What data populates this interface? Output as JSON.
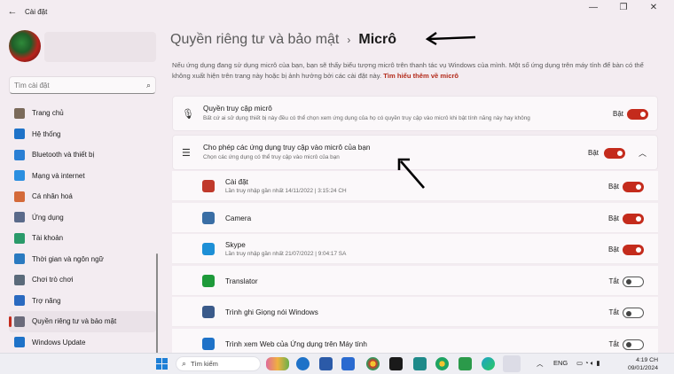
{
  "window": {
    "app_title": "Cài đặt",
    "controls": [
      "—",
      "❐",
      "✕"
    ]
  },
  "sidebar": {
    "search_placeholder": "Tìm cài đặt",
    "items": [
      {
        "label": "Trang chủ",
        "icon": "home-icon",
        "color": "#7a6a5a"
      },
      {
        "label": "Hệ thống",
        "icon": "display-icon",
        "color": "#1e72c8"
      },
      {
        "label": "Bluetooth và thiết bị",
        "icon": "bluetooth-icon",
        "color": "#2a7fd4"
      },
      {
        "label": "Mạng và internet",
        "icon": "wifi-icon",
        "color": "#2b8fe0"
      },
      {
        "label": "Cá nhân hoá",
        "icon": "brush-icon",
        "color": "#d46a3a"
      },
      {
        "label": "Ứng dụng",
        "icon": "apps-icon",
        "color": "#5a6a8a"
      },
      {
        "label": "Tài khoản",
        "icon": "person-icon",
        "color": "#2a9a6a"
      },
      {
        "label": "Thời gian và ngôn ngữ",
        "icon": "globe-clock-icon",
        "color": "#2a7ac0"
      },
      {
        "label": "Chơi trò chơi",
        "icon": "gamepad-icon",
        "color": "#5a6a7a"
      },
      {
        "label": "Trợ năng",
        "icon": "accessibility-icon",
        "color": "#2a6ac0"
      },
      {
        "label": "Quyền riêng tư và bảo mật",
        "icon": "shield-icon",
        "color": "#6a6a7a",
        "active": true
      },
      {
        "label": "Windows Update",
        "icon": "update-icon",
        "color": "#1e72c8"
      }
    ]
  },
  "header": {
    "parent": "Quyền riêng tư và bảo mật",
    "separator": "›",
    "current": "Micrô"
  },
  "description": {
    "text": "Nếu ứng dụng đang sử dụng micrô của bạn, bạn sẽ thấy biểu tượng micrô trên thanh tác vụ Windows của mình. Một số ứng dụng trên máy tính để bàn có thể không xuất hiện trên trang này hoặc bị ảnh hưởng bởi các cài đặt này.",
    "link": "Tìm hiểu thêm về micrô"
  },
  "mic_access": {
    "title": "Quyền truy cập micrô",
    "subtitle": "Bất cứ ai sử dụng thiết bị này đều có thể chọn xem ứng dụng của họ có quyền truy cập vào micrô khi bật tính năng này hay không",
    "state": "Bật"
  },
  "app_access": {
    "title": "Cho phép các ứng dụng truy cập vào micrô của bạn",
    "subtitle": "Chọn các ứng dụng có thể truy cập vào micrô của bạn",
    "state": "Bật"
  },
  "apps": [
    {
      "name": "Cài đặt",
      "sub": "Lần truy nhập gần nhất 14/11/2022  |  3:15:24 CH",
      "state": "Bật",
      "on": true,
      "color": "#c0392b",
      "icon": "settings-gear-icon"
    },
    {
      "name": "Camera",
      "sub": "",
      "state": "Bật",
      "on": true,
      "color": "#3a6ea5",
      "icon": "camera-icon"
    },
    {
      "name": "Skype",
      "sub": "Lần truy nhập gần nhất 21/07/2022  |  9:04:17 SA",
      "state": "Bật",
      "on": true,
      "color": "#1d8fd6",
      "icon": "skype-icon"
    },
    {
      "name": "Translator",
      "sub": "",
      "state": "Tắt",
      "on": false,
      "color": "#1e9a3a",
      "icon": "translator-icon"
    },
    {
      "name": "Trình ghi Giọng nói Windows",
      "sub": "",
      "state": "Tắt",
      "on": false,
      "color": "#3a5a8a",
      "icon": "voice-recorder-icon"
    },
    {
      "name": "Trình xem Web của Ứng dụng trên Máy tính",
      "sub": "",
      "state": "Tắt",
      "on": false,
      "color": "#1e72c8",
      "icon": "webview-icon"
    }
  ],
  "taskbar": {
    "search_label": "Tìm kiếm",
    "lang": "ENG",
    "time": "4:19 CH",
    "date": "09/01/2024"
  }
}
